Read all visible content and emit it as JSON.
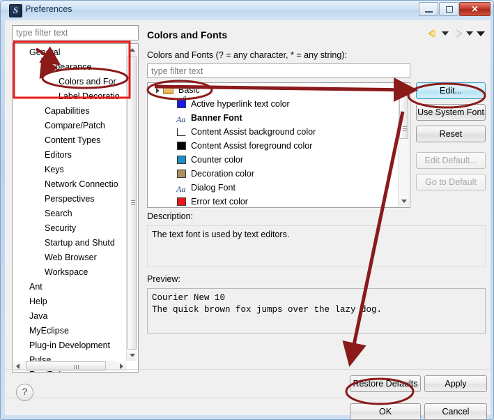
{
  "window": {
    "title": "Preferences",
    "icon": "eclipse-icon",
    "controls": {
      "minimize": "minimize-icon",
      "maximize": "maximize-icon",
      "close": "✕"
    }
  },
  "sidebar": {
    "filter_placeholder": "type filter text",
    "items": [
      {
        "label": "General",
        "level": 0
      },
      {
        "label": "Appearance",
        "level": 1
      },
      {
        "label": "Colors and For",
        "level": 2,
        "selected": true
      },
      {
        "label": "Label Decoratio",
        "level": 2
      },
      {
        "label": "Capabilities",
        "level": 1
      },
      {
        "label": "Compare/Patch",
        "level": 1
      },
      {
        "label": "Content Types",
        "level": 1
      },
      {
        "label": "Editors",
        "level": 1
      },
      {
        "label": "Keys",
        "level": 1
      },
      {
        "label": "Network Connectio",
        "level": 1
      },
      {
        "label": "Perspectives",
        "level": 1
      },
      {
        "label": "Search",
        "level": 1
      },
      {
        "label": "Security",
        "level": 1
      },
      {
        "label": "Startup and Shutd",
        "level": 1
      },
      {
        "label": "Web Browser",
        "level": 1
      },
      {
        "label": "Workspace",
        "level": 1
      },
      {
        "label": "Ant",
        "level": 0
      },
      {
        "label": "Help",
        "level": 0
      },
      {
        "label": "Java",
        "level": 0
      },
      {
        "label": "MyEclipse",
        "level": 0
      },
      {
        "label": "Plug-in Development",
        "level": 0
      },
      {
        "label": "Pulse",
        "level": 0
      },
      {
        "label": "Run/Debug",
        "level": 0
      }
    ]
  },
  "main": {
    "page_title": "Colors and Fonts",
    "nav": {
      "back": "back-arrow-icon",
      "back_menu": "chevron-down-icon",
      "forward": "forward-arrow-icon",
      "forward_menu": "chevron-down-icon",
      "view_menu": "chevron-down-icon"
    },
    "filter_hint": "Colors and Fonts (? = any character, * = any string):",
    "filter_placeholder": "type filter text",
    "tree_root": {
      "label": "Basic",
      "icon": "folder-font-icon"
    },
    "entries": [
      {
        "label": "Active hyperlink text color",
        "kind": "color",
        "color": "#1818F0"
      },
      {
        "label": "Banner Font",
        "kind": "font",
        "glyph": "Aa",
        "bold": true
      },
      {
        "label": "Content Assist background color",
        "kind": "color",
        "color": "#FFFFFF"
      },
      {
        "label": "Content Assist foreground color",
        "kind": "color",
        "color": "#000000"
      },
      {
        "label": "Counter color",
        "kind": "color",
        "color": "#1C8FC4"
      },
      {
        "label": "Decoration color",
        "kind": "color",
        "color": "#B09060"
      },
      {
        "label": "Dialog Font",
        "kind": "font",
        "glyph": "Aa",
        "bold": false
      },
      {
        "label": "Error text color",
        "kind": "color",
        "color": "#F01414"
      }
    ],
    "side_buttons": [
      {
        "label": "Edit...",
        "state": "primary"
      },
      {
        "label": "Use System Font",
        "state": "normal"
      },
      {
        "label": "Reset",
        "state": "normal"
      },
      {
        "label": "Edit Default...",
        "state": "disabled"
      },
      {
        "label": "Go to Default",
        "state": "disabled"
      }
    ],
    "description_label": "Description:",
    "description_text": "The text font is used by text editors.",
    "preview_label": "Preview:",
    "preview_line1": "Courier New 10",
    "preview_line2": "The quick brown fox jumps over the lazy dog."
  },
  "footer": {
    "restore_defaults": "Restore Defaults",
    "apply": "Apply",
    "ok": "OK",
    "cancel": "Cancel",
    "help": "?"
  },
  "annotations": {
    "rect_color": "#e81b1b",
    "ellipse_color": "#8b1a1a",
    "arrow_color": "#8b1a1a"
  }
}
